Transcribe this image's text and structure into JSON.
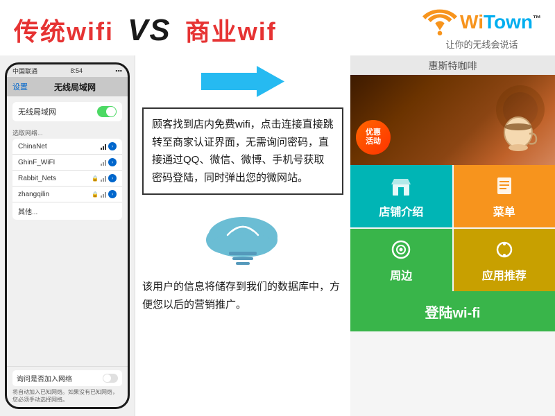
{
  "header": {
    "title_part1": "传统wifi",
    "title_vs": "VS",
    "title_part2": "商业wif",
    "logo": {
      "wi": "Wi",
      "town": "Town",
      "tm": "™",
      "subtitle": "让你的无线会说话"
    }
  },
  "phone": {
    "status_bar": {
      "carrier": "中国联通",
      "time": "8:54"
    },
    "nav": {
      "back": "设置",
      "title": "无线局域网"
    },
    "wifi_section": {
      "label": "无线局域网",
      "toggle": "on"
    },
    "network_section_label": "选取网络...",
    "networks": [
      {
        "name": "ChinaNet",
        "security": false,
        "signal": "strong"
      },
      {
        "name": "GhinF_WiFI",
        "security": false,
        "signal": "medium"
      },
      {
        "name": "Rabbit_Nets",
        "security": true,
        "signal": "medium"
      },
      {
        "name": "zhangqilin",
        "security": true,
        "signal": "medium"
      },
      {
        "name": "其他...",
        "security": false,
        "signal": "none"
      }
    ],
    "ask_join_label": "询问是否加入网络",
    "ask_join_toggle": "off",
    "footer_text": "将自动加入已知网络。如果没有已知网络，您必须手动选择网络。"
  },
  "middle": {
    "main_text": "顾客找到店内免费wifi，点击连接直接跳转至商家认证界面，无需询问密码，直接通过QQ、微信、微博、手机号获取密码登陆，同时弹出您的微网站。",
    "cloud_text": "该用户的信息将储存到我们的数据库中，方便您以后的营销推广。"
  },
  "right": {
    "store_name": "惠斯特咖啡",
    "promo_badge": [
      "优惠",
      "活动"
    ],
    "grid_items": [
      {
        "label": "店铺介绍",
        "color": "teal"
      },
      {
        "label": "菜单",
        "color": "orange"
      },
      {
        "label": "周边",
        "color": "green"
      },
      {
        "label": "应用推荐",
        "color": "gold"
      }
    ],
    "login_label": "登陆wi-fi"
  }
}
